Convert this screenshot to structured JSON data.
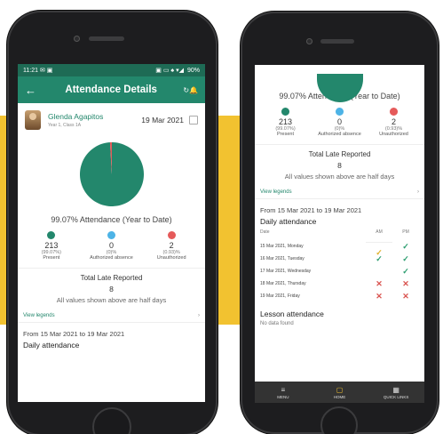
{
  "phone1": {
    "status": {
      "time": "11:21",
      "left_icons": "✉ ▣",
      "right_icons": "▣ ▭ ♠ ▾◢",
      "battery": "90%"
    },
    "appbar": {
      "title": "Attendance Details",
      "action": "↻🔔"
    },
    "student": {
      "name": "Glenda Agapitos",
      "class": "Year 1, Class 1A",
      "date": "19 Mar 2021"
    },
    "summary": {
      "title": "99.07% Attendance (Year to Date)",
      "stats": [
        {
          "count": "213",
          "pct": "(99.07%)",
          "label": "Present",
          "color": "#23876c"
        },
        {
          "count": "0",
          "pct": "(0)%",
          "label": "Authorized absence",
          "color": "#4db3e6"
        },
        {
          "count": "2",
          "pct": "(0.93)%",
          "label": "Unauthorized",
          "color": "#e55a5a"
        }
      ],
      "late_title": "Total Late Reported",
      "late_count": "8",
      "late_note": "All values shown above are half days"
    },
    "legends_link": "View legends",
    "range": "From 15 Mar 2021 to 19 Mar 2021",
    "daily_title": "Daily attendance"
  },
  "chart_data": {
    "type": "pie",
    "categories": [
      "Present",
      "Authorized absence",
      "Unauthorized"
    ],
    "values": [
      213,
      0,
      2
    ],
    "colors": [
      "#23876c",
      "#4db3e6",
      "#e55a5a"
    ]
  },
  "phone2": {
    "summary": {
      "title": "99.07% Attendance (Year to Date)",
      "stats": [
        {
          "count": "213",
          "pct": "(99.07%)",
          "label": "Present",
          "color": "#23876c"
        },
        {
          "count": "0",
          "pct": "(0)%",
          "label": "Authorized absence",
          "color": "#4db3e6"
        },
        {
          "count": "2",
          "pct": "(0.93)%",
          "label": "Unauthorized",
          "color": "#e55a5a"
        }
      ],
      "late_title": "Total Late Reported",
      "late_count": "8",
      "late_note": "All values shown above are half days"
    },
    "legends_link": "View legends",
    "range": "From 15 Mar 2021 to 19 Mar 2021",
    "daily_title": "Daily attendance",
    "table": {
      "headers": {
        "date": "Date",
        "am": "AM",
        "pm": "PM"
      },
      "rows": [
        {
          "date": "15 Mar 2021, Monday",
          "am": "✓",
          "am_type": "late",
          "pm": "✓",
          "pm_type": "tick"
        },
        {
          "date": "16 Mar 2021, Tuesday",
          "am": "✓",
          "am_type": "tick",
          "pm": "✓",
          "pm_type": "tick"
        },
        {
          "date": "17 Mar 2021, Wednesday",
          "am": "",
          "am_type": "",
          "pm": "✓",
          "pm_type": "tick"
        },
        {
          "date": "18 Mar 2021, Thursday",
          "am": "✕",
          "am_type": "cross",
          "pm": "✕",
          "pm_type": "cross"
        },
        {
          "date": "19 Mar 2021, Friday",
          "am": "✕",
          "am_type": "cross",
          "pm": "✕",
          "pm_type": "cross"
        }
      ]
    },
    "lesson_title": "Lesson attendance",
    "no_data": "No data found",
    "nav": [
      {
        "icon": "≡",
        "label": "MENU"
      },
      {
        "icon": "▢",
        "label": "HOME"
      },
      {
        "icon": "▦",
        "label": "QUICK LINKS"
      }
    ]
  }
}
